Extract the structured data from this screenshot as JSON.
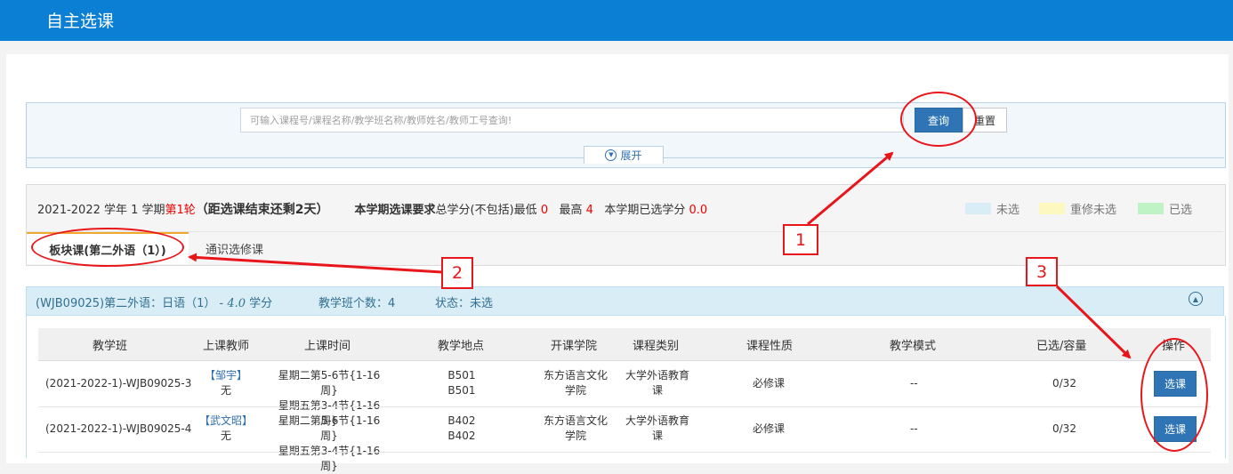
{
  "app": {
    "title": "自主选课"
  },
  "search": {
    "placeholder": "可输入课程号/课程名称/教学班名称/教师姓名/教师工号查询!",
    "query_label": "查询",
    "reset_label": "重置",
    "expand_label": "展开",
    "expand_icon": "chevron-down-icon"
  },
  "term": {
    "year_text": "2021-2022 学年 1 学期",
    "round": "第1轮",
    "remaining": "（距选课结束还剩2天）",
    "req_label": "本学期选课要求",
    "req_text": "总学分(不包括)最低",
    "min_credit": "0",
    "max_label": "最高",
    "max_credit": "4",
    "selected_label": "本学期已选学分",
    "selected_credit": "0.0"
  },
  "legend": [
    {
      "label": "未选",
      "color": "#d9edf7"
    },
    {
      "label": "重修未选",
      "color": "#fcf8c0"
    },
    {
      "label": "已选",
      "color": "#bff2c4"
    }
  ],
  "tabs": [
    {
      "label": "板块课(第二外语（1）)"
    },
    {
      "label": "通识选修课"
    }
  ],
  "course": {
    "title": "(WJB09025)第二外语：日语（1） - ",
    "credit": "4.0",
    "credit_unit": " 学分",
    "class_count_label": "教学班个数：",
    "class_count": "4",
    "status_label": "状态：",
    "status": "未选",
    "collapse_icon": "chevron-up-icon"
  },
  "table": {
    "headers": [
      "教学班",
      "上课教师",
      "上课时间",
      "教学地点",
      "开课学院",
      "课程类别",
      "课程性质",
      "教学模式",
      "已选/容量",
      "操作"
    ],
    "rows": [
      {
        "class": "(2021-2022-1)-WJB09025-3",
        "teacher": "【邹宇】",
        "teacher2": "无",
        "time1": "星期二第5-6节{1-16周}",
        "time2": "星期五第3-4节{1-16周}",
        "place1": "B501",
        "place2": "B501",
        "college1": "东方语言文化",
        "college2": "学院",
        "category1": "大学外语教育",
        "category2": "课",
        "nature": "必修课",
        "mode": "--",
        "capacity": "0/32",
        "action": "选课"
      },
      {
        "class": "(2021-2022-1)-WJB09025-4",
        "teacher": "【武文昭】",
        "teacher2": "无",
        "time1": "星期二第5-6节{1-16周}",
        "time2": "星期五第3-4节{1-16周}",
        "place1": "B402",
        "place2": "B402",
        "college1": "东方语言文化",
        "college2": "学院",
        "category1": "大学外语教育",
        "category2": "课",
        "nature": "必修课",
        "mode": "--",
        "capacity": "0/32",
        "action": "选课"
      }
    ]
  },
  "annotations": [
    "1",
    "2",
    "3"
  ],
  "colors": {
    "header": "#0a7fd3",
    "primary_button": "#2f75b5",
    "annotation": "#e8161b",
    "highlight_red": "#ee0000"
  }
}
